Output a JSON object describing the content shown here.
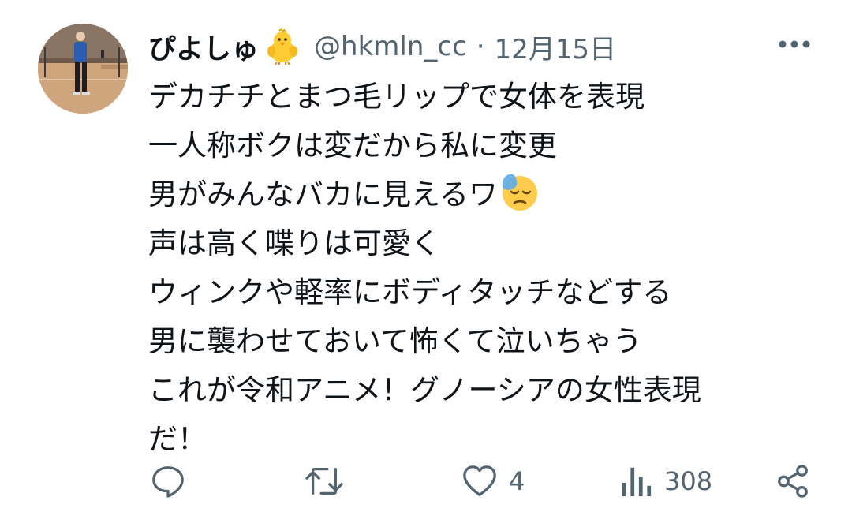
{
  "tweet": {
    "display_name": "ぴよしゅ",
    "name_emoji": "chick-emoji",
    "handle": "@hkmln_cc",
    "separator": "·",
    "date": "12月15日",
    "lines": [
      "デカチチとまつ毛リップで女体を表現",
      "一人称ボクは変だから私に変更",
      "男がみんなバカに見えるワ",
      "声は高く喋りは可愛く",
      "ウィンクや軽率にボディタッチなどする",
      "男に襲わせておいて怖くて泣いちゃう",
      "これが令和アニメ！グノーシアの女性表現",
      "だ！"
    ],
    "inline_emoji_line3": "downcast-face-with-sweat-emoji"
  },
  "actions": {
    "reply": {
      "icon": "reply-icon",
      "count": ""
    },
    "retweet": {
      "icon": "retweet-icon",
      "count": ""
    },
    "like": {
      "icon": "heart-icon",
      "count": "4"
    },
    "views": {
      "icon": "views-icon",
      "count": "308"
    },
    "share": {
      "icon": "share-icon"
    }
  },
  "colors": {
    "text": "#0f1419",
    "secondary": "#536471"
  }
}
